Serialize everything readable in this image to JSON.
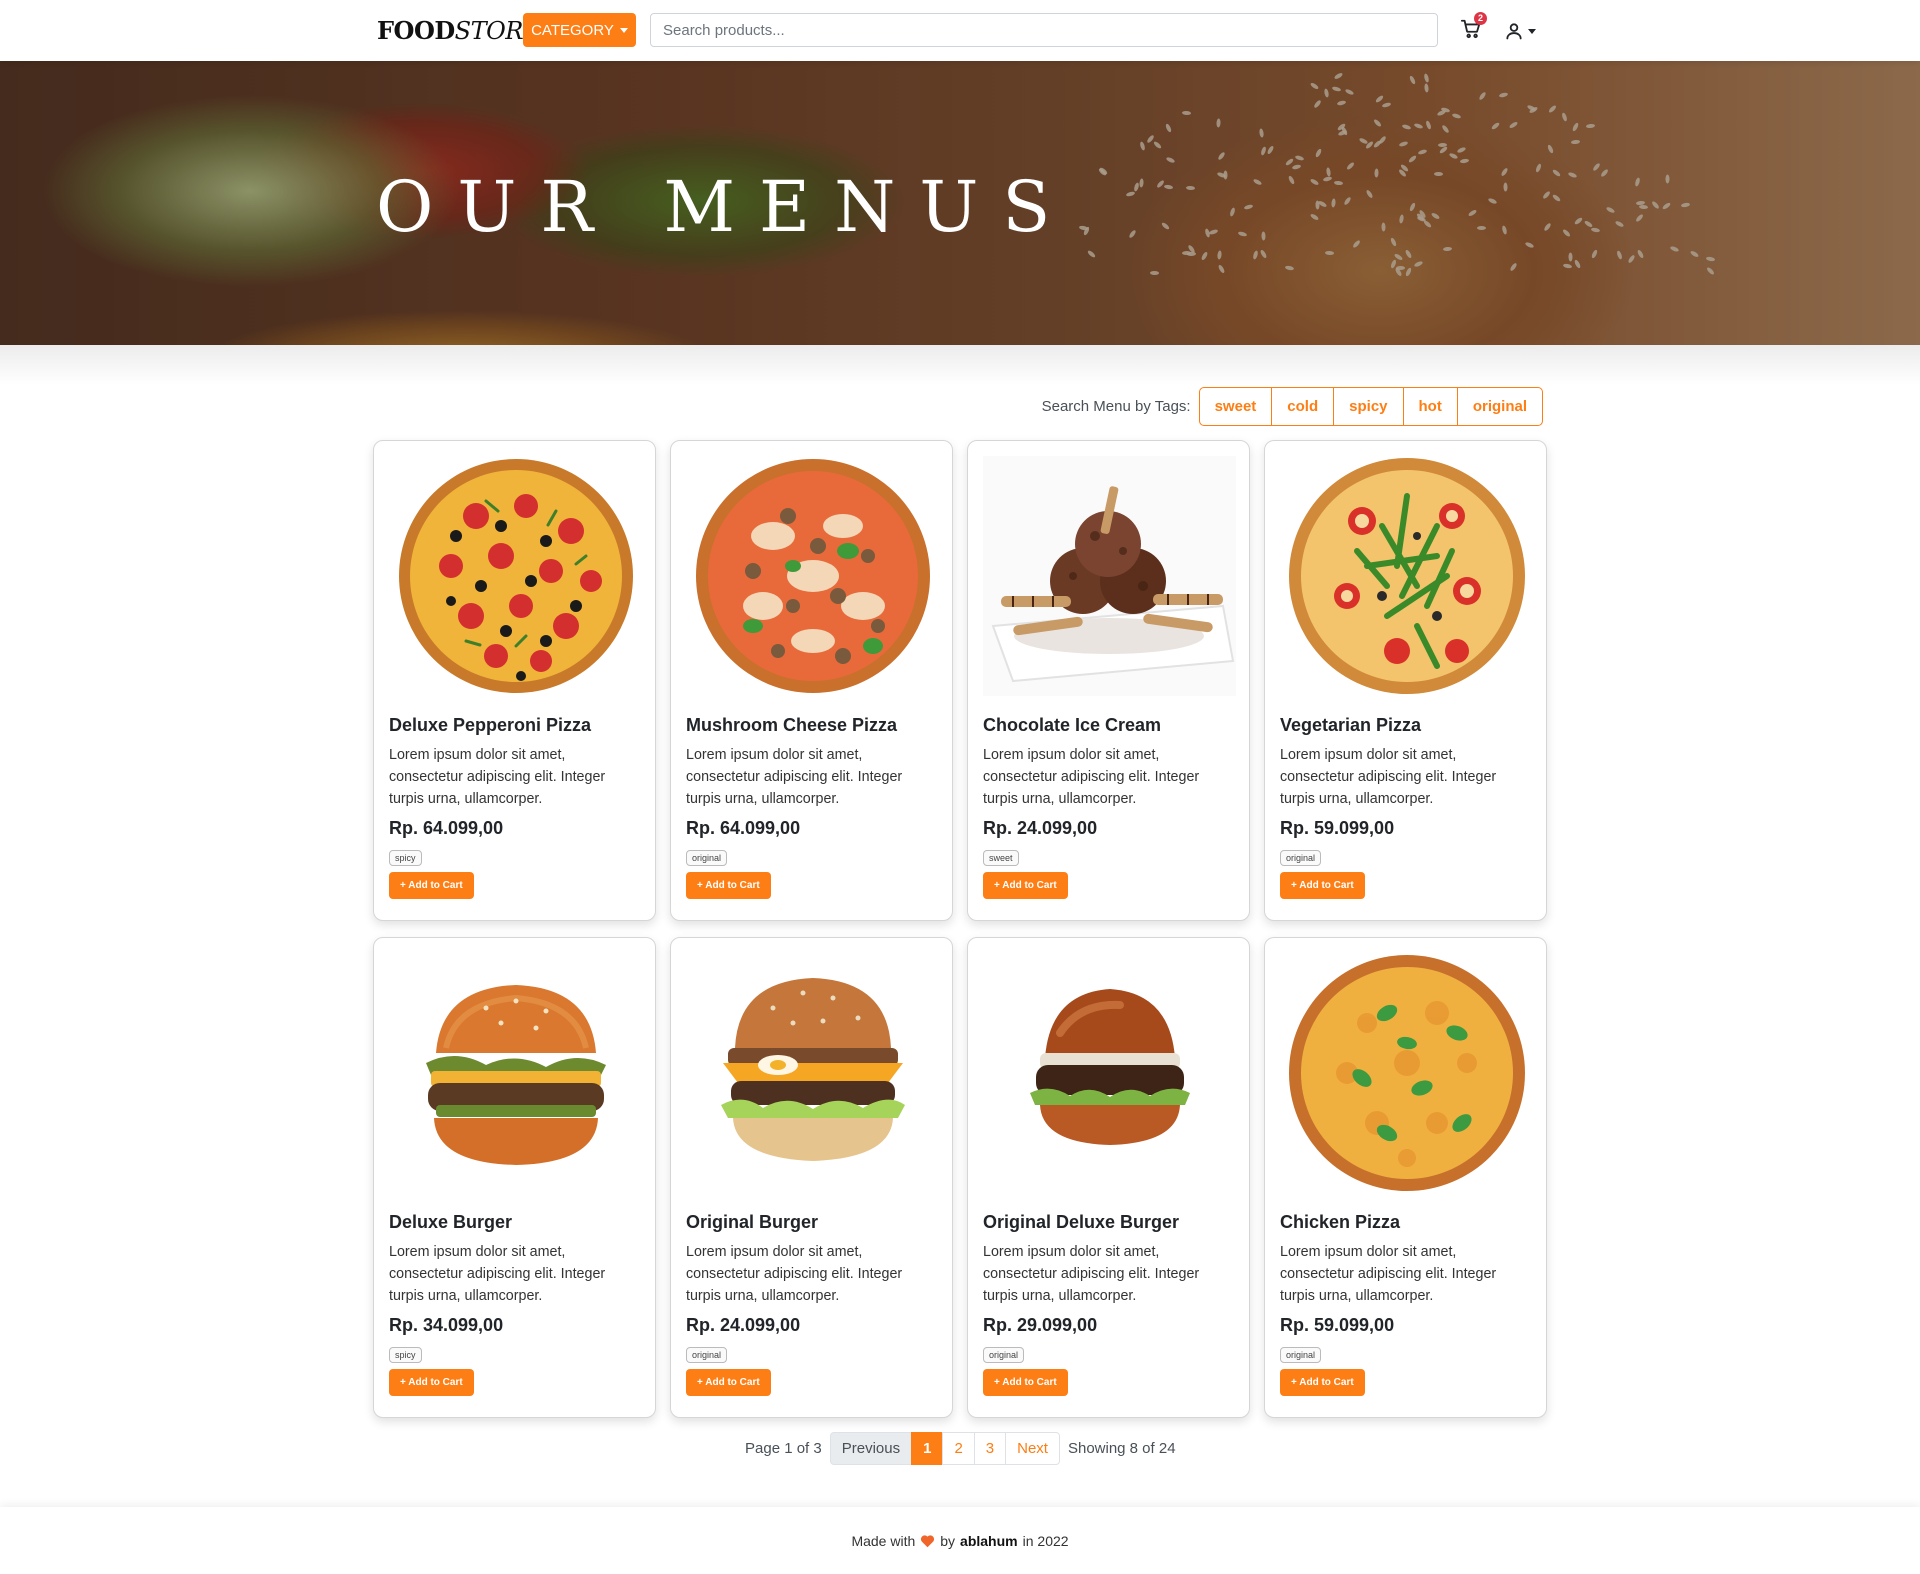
{
  "nav": {
    "brand_bold": "FOOD",
    "brand_italic": "STORE",
    "category_label": "CATEGORY",
    "search_placeholder": "Search products...",
    "cart_count": "2",
    "icons": [
      "cart-icon",
      "user-icon",
      "caret-down-icon"
    ]
  },
  "hero": {
    "title": "OUR MENUS"
  },
  "tags": {
    "label": "Search Menu by Tags:",
    "items": [
      "sweet",
      "cold",
      "spicy",
      "hot",
      "original"
    ]
  },
  "products": [
    {
      "name": "Deluxe Pepperoni Pizza",
      "description": "Lorem ipsum dolor sit amet, consectetur adipiscing elit. Integer turpis urna, ullamcorper.",
      "price": "Rp. 64.099,00",
      "tag": "spicy",
      "button": "+ Add to Cart",
      "image": "pepperoni-pizza"
    },
    {
      "name": "Mushroom Cheese Pizza",
      "description": "Lorem ipsum dolor sit amet, consectetur adipiscing elit. Integer turpis urna, ullamcorper.",
      "price": "Rp. 64.099,00",
      "tag": "original",
      "button": "+ Add to Cart",
      "image": "mushroom-pizza"
    },
    {
      "name": "Chocolate Ice Cream",
      "description": "Lorem ipsum dolor sit amet, consectetur adipiscing elit. Integer turpis urna, ullamcorper.",
      "price": "Rp. 24.099,00",
      "tag": "sweet",
      "button": "+ Add to Cart",
      "image": "chocolate-ice-cream"
    },
    {
      "name": "Vegetarian Pizza",
      "description": "Lorem ipsum dolor sit amet, consectetur adipiscing elit. Integer turpis urna, ullamcorper.",
      "price": "Rp. 59.099,00",
      "tag": "original",
      "button": "+ Add to Cart",
      "image": "vegetarian-pizza"
    },
    {
      "name": "Deluxe Burger",
      "description": "Lorem ipsum dolor sit amet, consectetur adipiscing elit. Integer turpis urna, ullamcorper.",
      "price": "Rp. 34.099,00",
      "tag": "spicy",
      "button": "+ Add to Cart",
      "image": "deluxe-burger"
    },
    {
      "name": "Original Burger",
      "description": "Lorem ipsum dolor sit amet, consectetur adipiscing elit. Integer turpis urna, ullamcorper.",
      "price": "Rp. 24.099,00",
      "tag": "original",
      "button": "+ Add to Cart",
      "image": "original-burger"
    },
    {
      "name": "Original Deluxe Burger",
      "description": "Lorem ipsum dolor sit amet, consectetur adipiscing elit. Integer turpis urna, ullamcorper.",
      "price": "Rp. 29.099,00",
      "tag": "original",
      "button": "+ Add to Cart",
      "image": "original-deluxe-burger"
    },
    {
      "name": "Chicken Pizza",
      "description": "Lorem ipsum dolor sit amet, consectetur adipiscing elit. Integer turpis urna, ullamcorper.",
      "price": "Rp. 59.099,00",
      "tag": "original",
      "button": "+ Add to Cart",
      "image": "chicken-pizza"
    }
  ],
  "pagination": {
    "info": "Page 1 of 3",
    "previous": "Previous",
    "pages": [
      "1",
      "2",
      "3"
    ],
    "active_page": "1",
    "next": "Next",
    "showing": "Showing 8 of 24"
  },
  "footer": {
    "made_with": "Made with",
    "by": "by",
    "author": "ablahum",
    "year_text": "in 2022",
    "heart_color": "#f06529"
  },
  "colors": {
    "accent": "#fd7e14",
    "badge": "#dc3545"
  }
}
